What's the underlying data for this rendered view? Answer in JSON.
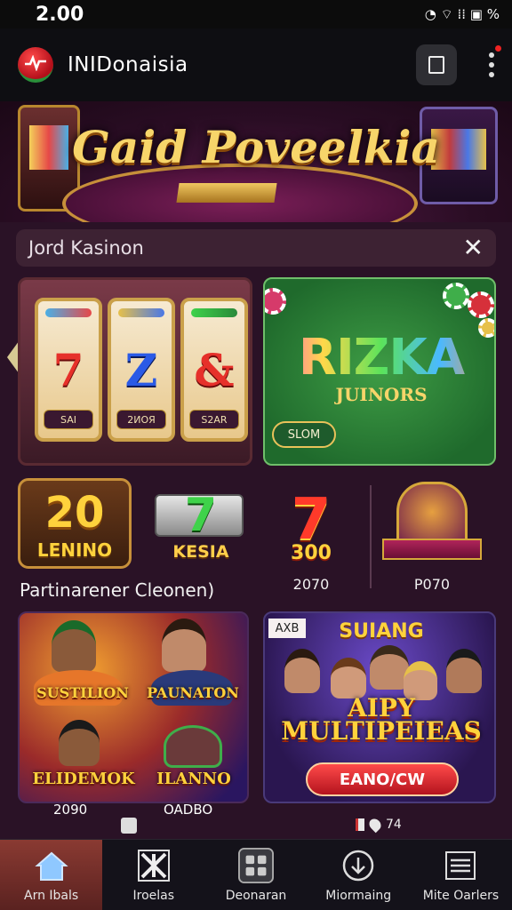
{
  "status": {
    "time": "2.00",
    "icons": "◔ ⌔ ⁞⁞ ▣ %"
  },
  "app": {
    "title": "INIDonaisia"
  },
  "hero": {
    "title": "Gaid Poveelkia"
  },
  "search": {
    "value": "Jord Kasinon"
  },
  "slots_card": {
    "reels": [
      {
        "symbol": "7",
        "label": "SAI"
      },
      {
        "symbol": "Z",
        "label": "2ИOЯ"
      },
      {
        "symbol": "&",
        "label": "S2AR"
      }
    ]
  },
  "rizka_card": {
    "title": "RIZKA",
    "subtitle": "JUINORS",
    "button": "SLOM"
  },
  "promos": {
    "tile1": {
      "big": "20",
      "label": "LENINO"
    },
    "tile2": {
      "label": "KESIA"
    },
    "tile3": {
      "label": "300",
      "year": "2070"
    },
    "tile4": {
      "year": "P070"
    },
    "caption": "Partinarener Cleonen)"
  },
  "people_card": {
    "badges": [
      "SUSTILION",
      "PAUNATON",
      "ELIDEMOK",
      "ILANNO"
    ],
    "years": [
      "2090",
      "OADBO"
    ]
  },
  "multi_card": {
    "badge": "AXB",
    "top": "SUIANG",
    "title": "AIPY MULTIPEIEAS",
    "button": "EANO/CW"
  },
  "mini": {
    "count": "74"
  },
  "nav": [
    {
      "label": "Arn Ibals"
    },
    {
      "label": "Iroelas"
    },
    {
      "label": "Deonaran"
    },
    {
      "label": "Miormaing"
    },
    {
      "label": "Mite Oarlers"
    }
  ]
}
